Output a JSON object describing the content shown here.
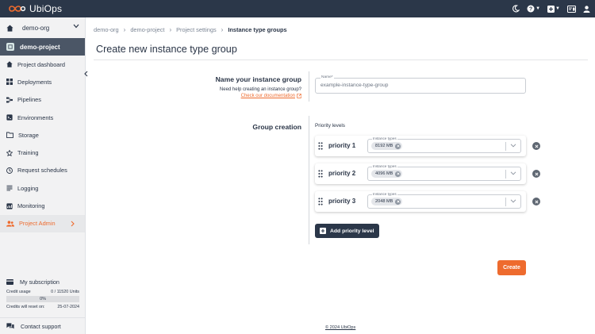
{
  "app": {
    "name": "UbiOps"
  },
  "colors": {
    "topbar": "#2b3749",
    "accent": "#ee6b2e",
    "sidebar_bg": "#f2f2f3",
    "project_row_bg": "#4b5666"
  },
  "topbar_icons": [
    "theme-moon-icon",
    "help-icon",
    "add-icon",
    "notifications-icon",
    "user-icon"
  ],
  "sidebar": {
    "organization": "demo-org",
    "project": "demo-project",
    "items": [
      {
        "label": "Project dashboard",
        "icon": "home-icon"
      },
      {
        "label": "Deployments",
        "icon": "deployments-icon"
      },
      {
        "label": "Pipelines",
        "icon": "pipelines-icon"
      },
      {
        "label": "Environments",
        "icon": "environments-icon"
      },
      {
        "label": "Storage",
        "icon": "folder-icon"
      },
      {
        "label": "Training",
        "icon": "training-icon"
      },
      {
        "label": "Request schedules",
        "icon": "clock-icon"
      },
      {
        "label": "Logging",
        "icon": "logging-icon"
      },
      {
        "label": "Monitoring",
        "icon": "monitoring-icon"
      },
      {
        "label": "Project Admin",
        "icon": "users-icon",
        "active": true
      }
    ],
    "subscription": {
      "title": "My subscription",
      "credit_usage_label": "Credit usage",
      "credit_usage_value": "0 / 11520 Units",
      "progress_percent": 0,
      "progress_label": "0%",
      "reset_label": "Credits will reset on:",
      "reset_date": "25-07-2024"
    },
    "support": "Contact support"
  },
  "breadcrumb": [
    "demo-org",
    "demo-project",
    "Project settings",
    "Instance type groups"
  ],
  "page": {
    "title": "Create new instance type group",
    "name_section": {
      "title": "Name your instance group",
      "help": "Need help creating an instance group?",
      "doc_link": "Check our documentation",
      "field_label": "Name*",
      "field_placeholder": "example-instance-type-group",
      "field_value": ""
    },
    "group_section": {
      "title": "Group creation",
      "priority_label": "Priority levels",
      "select_label": "Instance types",
      "priorities": [
        {
          "name": "priority 1",
          "types": [
            "8192 MB"
          ]
        },
        {
          "name": "priority 2",
          "types": [
            "4096 MB"
          ]
        },
        {
          "name": "priority 3",
          "types": [
            "2048 MB"
          ]
        }
      ],
      "add_button": "Add priority level"
    },
    "create_button": "Create"
  },
  "footer": "© 2024 UbiOps"
}
